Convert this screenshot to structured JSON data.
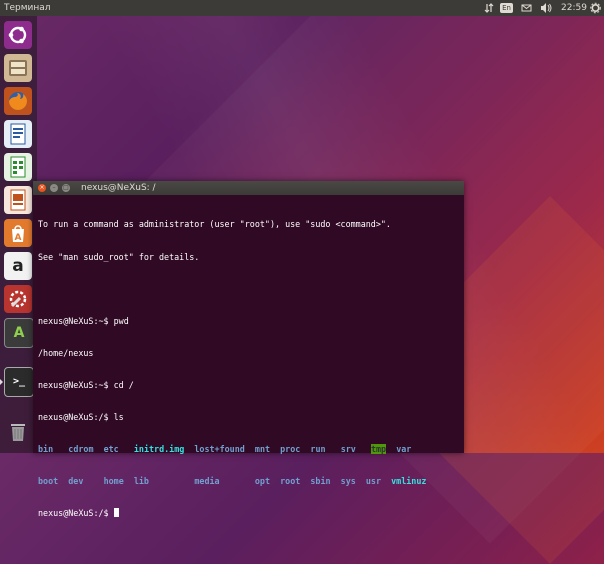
{
  "panel": {
    "app_title": "Терминал",
    "keyboard_layout": "En",
    "clock": "22:59"
  },
  "launcher": {
    "items": [
      {
        "name": "dash-home",
        "icon": "ubuntu-logo-icon"
      },
      {
        "name": "files",
        "icon": "file-cabinet-icon"
      },
      {
        "name": "firefox",
        "icon": "firefox-icon"
      },
      {
        "name": "writer",
        "icon": "libreoffice-writer-icon"
      },
      {
        "name": "calc",
        "icon": "libreoffice-calc-icon"
      },
      {
        "name": "impress",
        "icon": "libreoffice-impress-icon"
      },
      {
        "name": "software-center",
        "icon": "ubuntu-software-icon"
      },
      {
        "name": "amazon",
        "icon": "amazon-icon",
        "glyph": "a"
      },
      {
        "name": "system-settings",
        "icon": "settings-icon"
      },
      {
        "name": "software-updater",
        "icon": "updater-icon",
        "glyph": "A"
      },
      {
        "name": "terminal",
        "icon": "terminal-icon",
        "glyph": ">_"
      },
      {
        "name": "trash",
        "icon": "trash-icon"
      }
    ]
  },
  "terminal": {
    "title": "nexus@NeXuS: /",
    "motd": [
      "To run a command as administrator (user \"root\"), use \"sudo <command>\".",
      "See \"man sudo_root\" for details."
    ],
    "prompt1": "nexus@NeXuS:~$ ",
    "cmd1": "pwd",
    "out1": "/home/nexus",
    "prompt2": "nexus@NeXuS:~$ ",
    "cmd2": "cd /",
    "prompt3": "nexus@NeXuS:/$ ",
    "cmd3": "ls",
    "ls_row1": [
      "bin",
      "cdrom",
      "etc",
      "initrd.img",
      "lost+found",
      "mnt",
      "proc",
      "run",
      "srv",
      "tmp",
      "var"
    ],
    "ls_row2": [
      "boot",
      "dev",
      "home",
      "lib",
      "media",
      "opt",
      "root",
      "sbin",
      "sys",
      "usr",
      "vmlinuz"
    ],
    "prompt4": "nexus@NeXuS:/$ "
  },
  "colors": {
    "terminal_bg": "#300a24",
    "dir": "#729fcf",
    "symlink": "#34e2e2",
    "sticky_dir_bg": "#4e9a06",
    "panel_bg": "#3c3b37"
  }
}
